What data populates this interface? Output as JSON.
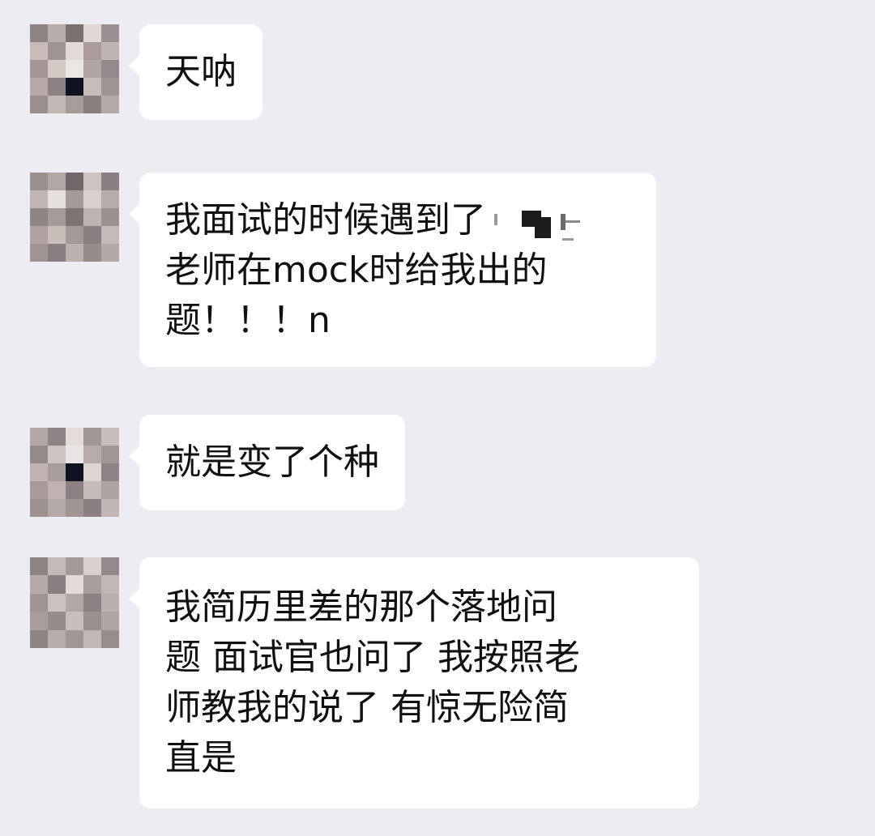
{
  "messages": [
    {
      "lines": [
        "天呐"
      ]
    },
    {
      "lines": [
        "我面试的时候遇到了",
        "老师在mock时给我出的",
        "题！！！n"
      ]
    },
    {
      "lines": [
        "就是变了个种"
      ]
    },
    {
      "lines": [
        "我简历里差的那个落地问",
        "题 面试官也问了 我按照老",
        "师教我的说了 有惊无险简",
        "直是"
      ]
    }
  ],
  "colors": {
    "background": "#ededf1",
    "bubble": "#ffffff",
    "text": "#111111"
  }
}
